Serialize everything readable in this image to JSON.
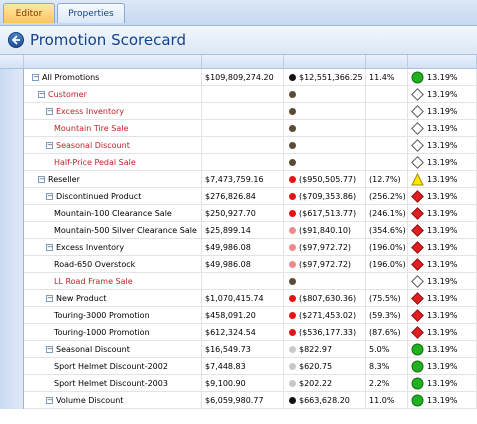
{
  "tabs": {
    "editor": "Editor",
    "properties": "Properties"
  },
  "title": "Promotion Scorecard",
  "colors": {
    "red": "#e81010",
    "black": "#111111",
    "brown": "#5b4a35",
    "pink": "#f08a8a",
    "gray": "#c8c8c8",
    "green": "#20b020",
    "yellow": "#ffe800",
    "diamond": "#e02020"
  },
  "rows": [
    {
      "name": "All Promotions",
      "level": 0,
      "expander": true,
      "red": false,
      "target": "$109,809,274.20",
      "dot": "black",
      "actual": "$12,551,366.25",
      "pct": "11.4%",
      "ind": "circle-green",
      "score": "13.19%"
    },
    {
      "name": "Customer",
      "level": 1,
      "expander": true,
      "red": true,
      "target": "",
      "dot": "brown",
      "actual": "",
      "pct": "",
      "ind": "diamond-empty",
      "score": "13.19%"
    },
    {
      "name": "Excess Inventory",
      "level": 2,
      "expander": true,
      "red": true,
      "target": "",
      "dot": "brown",
      "actual": "",
      "pct": "",
      "ind": "diamond-empty",
      "score": "13.19%"
    },
    {
      "name": "Mountain Tire Sale",
      "level": 3,
      "expander": false,
      "red": true,
      "target": "",
      "dot": "brown",
      "actual": "",
      "pct": "",
      "ind": "diamond-empty",
      "score": "13.19%"
    },
    {
      "name": "Seasonal Discount",
      "level": 2,
      "expander": true,
      "red": true,
      "target": "",
      "dot": "brown",
      "actual": "",
      "pct": "",
      "ind": "diamond-empty",
      "score": "13.19%"
    },
    {
      "name": "Half-Price Pedal Sale",
      "level": 3,
      "expander": false,
      "red": true,
      "target": "",
      "dot": "brown",
      "actual": "",
      "pct": "",
      "ind": "diamond-empty",
      "score": "13.19%"
    },
    {
      "name": "Reseller",
      "level": 1,
      "expander": true,
      "red": false,
      "target": "$7,473,759.16",
      "dot": "red",
      "actual": "($950,505.77)",
      "pct": "(12.7%)",
      "ind": "triangle-yellow",
      "score": "13.19%"
    },
    {
      "name": "Discontinued Product",
      "level": 2,
      "expander": true,
      "red": false,
      "target": "$276,826.84",
      "dot": "red",
      "actual": "($709,353.86)",
      "pct": "(256.2%)",
      "ind": "diamond-red",
      "score": "13.19%"
    },
    {
      "name": "Mountain-100 Clearance Sale",
      "level": 3,
      "expander": false,
      "red": false,
      "target": "$250,927.70",
      "dot": "red",
      "actual": "($617,513.77)",
      "pct": "(246.1%)",
      "ind": "diamond-red",
      "score": "13.19%"
    },
    {
      "name": "Mountain-500 Silver Clearance Sale",
      "level": 3,
      "expander": false,
      "red": false,
      "target": "$25,899.14",
      "dot": "pink",
      "actual": "($91,840.10)",
      "pct": "(354.6%)",
      "ind": "diamond-red",
      "score": "13.19%"
    },
    {
      "name": "Excess Inventory",
      "level": 2,
      "expander": true,
      "red": false,
      "target": "$49,986.08",
      "dot": "pink",
      "actual": "($97,972.72)",
      "pct": "(196.0%)",
      "ind": "diamond-red",
      "score": "13.19%"
    },
    {
      "name": "Road-650 Overstock",
      "level": 3,
      "expander": false,
      "red": false,
      "target": "$49,986.08",
      "dot": "pink",
      "actual": "($97,972.72)",
      "pct": "(196.0%)",
      "ind": "diamond-red",
      "score": "13.19%"
    },
    {
      "name": "LL Road Frame Sale",
      "level": 3,
      "expander": false,
      "red": true,
      "target": "",
      "dot": "brown",
      "actual": "",
      "pct": "",
      "ind": "diamond-empty",
      "score": "13.19%"
    },
    {
      "name": "New Product",
      "level": 2,
      "expander": true,
      "red": false,
      "target": "$1,070,415.74",
      "dot": "red",
      "actual": "($807,630.36)",
      "pct": "(75.5%)",
      "ind": "diamond-red",
      "score": "13.19%"
    },
    {
      "name": "Touring-3000 Promotion",
      "level": 3,
      "expander": false,
      "red": false,
      "target": "$458,091.20",
      "dot": "red",
      "actual": "($271,453.02)",
      "pct": "(59.3%)",
      "ind": "diamond-red",
      "score": "13.19%"
    },
    {
      "name": "Touring-1000 Promotion",
      "level": 3,
      "expander": false,
      "red": false,
      "target": "$612,324.54",
      "dot": "red",
      "actual": "($536,177.33)",
      "pct": "(87.6%)",
      "ind": "diamond-red",
      "score": "13.19%"
    },
    {
      "name": "Seasonal Discount",
      "level": 2,
      "expander": true,
      "red": false,
      "target": "$16,549.73",
      "dot": "gray",
      "actual": "$822.97",
      "pct": "5.0%",
      "ind": "circle-green",
      "score": "13.19%"
    },
    {
      "name": "Sport Helmet Discount-2002",
      "level": 3,
      "expander": false,
      "red": false,
      "target": "$7,448.83",
      "dot": "gray",
      "actual": "$620.75",
      "pct": "8.3%",
      "ind": "circle-green",
      "score": "13.19%"
    },
    {
      "name": "Sport Helmet Discount-2003",
      "level": 3,
      "expander": false,
      "red": false,
      "target": "$9,100.90",
      "dot": "gray",
      "actual": "$202.22",
      "pct": "2.2%",
      "ind": "circle-green",
      "score": "13.19%"
    },
    {
      "name": "Volume Discount",
      "level": 2,
      "expander": true,
      "red": false,
      "target": "$6,059,980.77",
      "dot": "black",
      "actual": "$663,628.20",
      "pct": "11.0%",
      "ind": "circle-green",
      "score": "13.19%"
    }
  ]
}
